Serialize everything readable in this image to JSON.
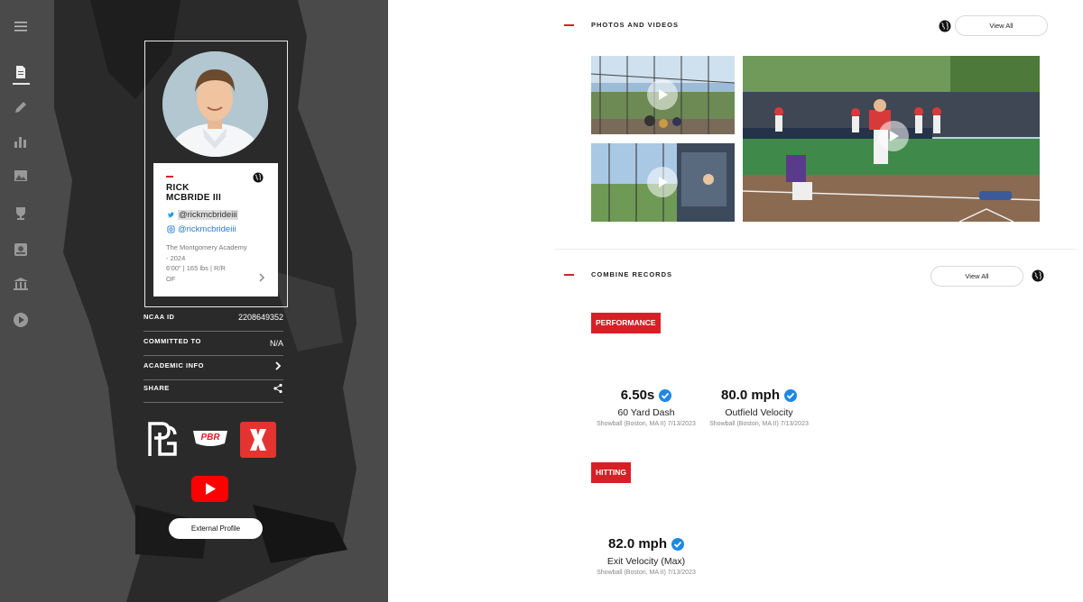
{
  "sidebar": {
    "icons": [
      "menu-icon",
      "document-icon",
      "pencil-icon",
      "bar-chart-icon",
      "image-icon",
      "trophy-icon",
      "mailbox-icon",
      "bank-icon",
      "play-circle-icon"
    ]
  },
  "profile": {
    "first_name": "RICK",
    "last_name": "MCBRIDE III",
    "twitter": "@rickmcbrideiii",
    "instagram": "@rickmcbrideiii",
    "school": "The Montgomery Academy",
    "class_year": "- 2024",
    "measurements": "6'00\" | 165 lbs | R/R",
    "position": "OF"
  },
  "info": {
    "ncaa_label": "NCAA ID",
    "ncaa_value": "2208649352",
    "committed_label": "COMMITTED TO",
    "committed_value": "N/A",
    "academic_label": "ACADEMIC INFO",
    "share_label": "SHARE"
  },
  "logos": {
    "pg": "PG",
    "pbr": "PBR",
    "x": "X"
  },
  "external_profile_label": "External Profile",
  "photos_videos": {
    "title": "PHOTOS AND VIDEOS",
    "view_all": "View All"
  },
  "combine": {
    "title": "COMBINE RECORDS",
    "view_all": "View All",
    "performance_tag": "PERFORMANCE",
    "hitting_tag": "HITTING",
    "stats": [
      {
        "value": "6.50s",
        "name": "60 Yard Dash",
        "source": "Showball (Boston, MA II) 7/13/2023"
      },
      {
        "value": "80.0 mph",
        "name": "Outfield Velocity",
        "source": "Showball (Boston, MA II) 7/13/2023"
      },
      {
        "value": "82.0 mph",
        "name": "Exit Velocity (Max)",
        "source": "Showball (Boston, MA II) 7/13/2023"
      }
    ]
  },
  "colors": {
    "accent_red": "#d81f26",
    "panel_bg": "#4a4a4a",
    "verified_blue": "#1e88e5"
  }
}
